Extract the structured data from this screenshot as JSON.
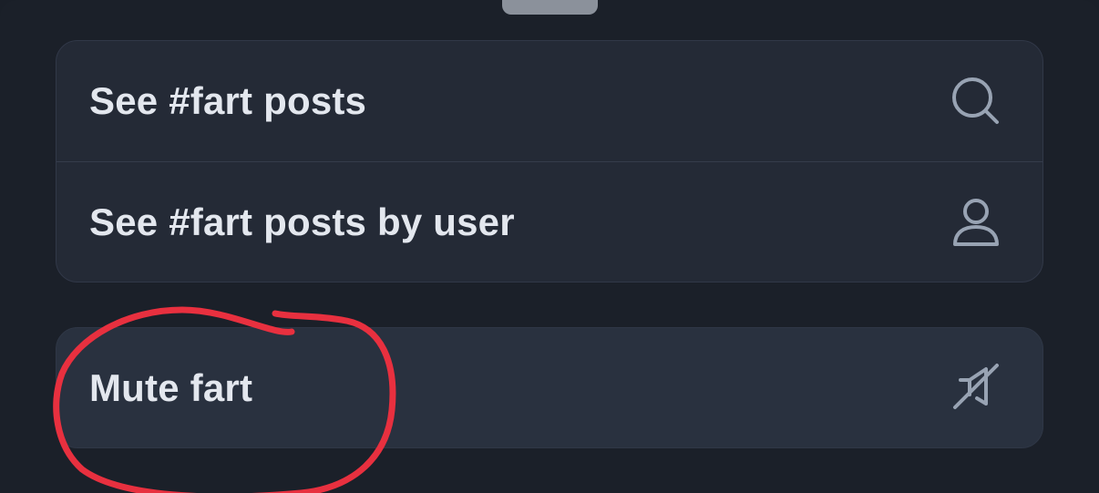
{
  "menu": {
    "items": [
      {
        "label": "See #fart posts",
        "icon": "search-icon"
      },
      {
        "label": "See #fart posts by user",
        "icon": "person-icon"
      }
    ],
    "mute": {
      "label": "Mute fart",
      "icon": "mute-icon"
    }
  },
  "colors": {
    "background": "#1b2029",
    "card": "#242a36",
    "text": "#e3e7ee",
    "icon": "#98a3b3",
    "annotation": "#e8303f"
  }
}
